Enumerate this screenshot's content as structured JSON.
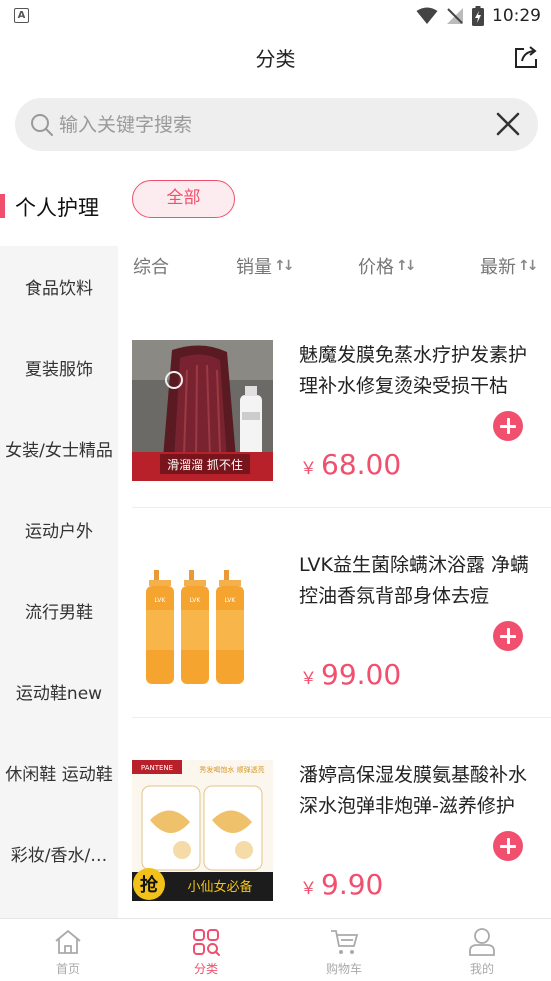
{
  "status_bar": {
    "time": "10:29",
    "app_icon_letter": "A"
  },
  "header": {
    "title": "分类"
  },
  "search": {
    "placeholder": "输入关键字搜索"
  },
  "sidebar": {
    "active_item": "个人护理",
    "items": [
      "食品饮料",
      "夏装服饰",
      "女装/女士精品",
      "运动户外",
      "流行男鞋",
      "运动鞋new",
      "休闲鞋 运动鞋",
      "彩妆/香水/…"
    ]
  },
  "filter": {
    "all_label": "全部"
  },
  "sort": {
    "items": [
      {
        "label": "综合",
        "arrows": ""
      },
      {
        "label": "销量",
        "arrows": "↑↓"
      },
      {
        "label": "价格",
        "arrows": "↑↓"
      },
      {
        "label": "最新",
        "arrows": "↑↓"
      }
    ]
  },
  "products": [
    {
      "name": "魅魔发膜免蒸水疗护发素护理补水修复烫染受损干枯",
      "currency": "￥",
      "price": "68.00",
      "image_caption": "滑溜溜 抓不住"
    },
    {
      "name": "LVK益生菌除螨沐浴露 净螨控油香氛背部身体去痘",
      "currency": "￥",
      "price": "99.00",
      "image_caption": "LVK"
    },
    {
      "name": "潘婷高保湿发膜氨基酸补水深水泡弹非炮弹-滋养修护",
      "currency": "￥",
      "price": "9.90",
      "image_caption": "小仙女必备",
      "image_badge": "抢",
      "image_brand": "PANTENE",
      "image_slogan": "秀发喝饱水 顺弹透亮"
    }
  ],
  "tabbar": {
    "items": [
      {
        "label": "首页",
        "icon": "home-icon"
      },
      {
        "label": "分类",
        "icon": "category-icon"
      },
      {
        "label": "购物车",
        "icon": "cart-icon"
      },
      {
        "label": "我的",
        "icon": "profile-icon"
      }
    ],
    "active": "分类"
  },
  "colors": {
    "accent": "#f0506e",
    "sidebar_bg": "#f5f5f5",
    "search_bg": "#eeeeee"
  }
}
